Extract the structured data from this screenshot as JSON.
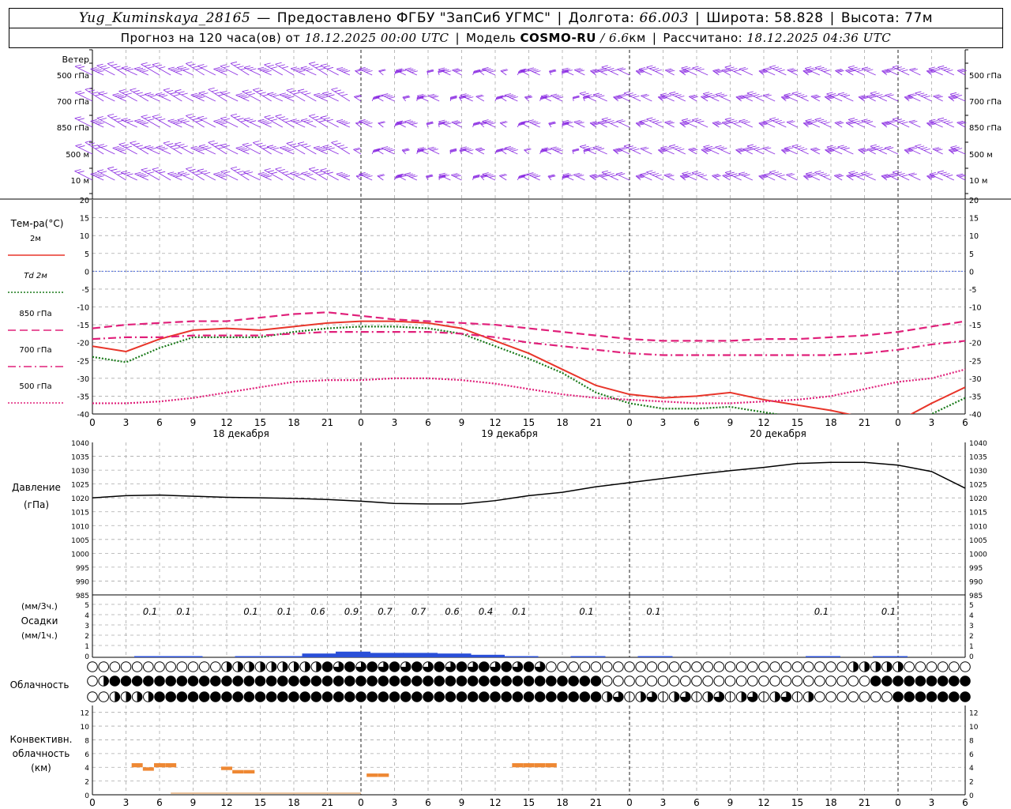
{
  "header": {
    "station": "Yug_Kuminskaya_28165",
    "dash": "—",
    "provider": "Предоставлено ФГБУ \"ЗапСиб УГМС\"",
    "lon_label": "Долгота:",
    "lon": "66.003",
    "lat_label": "Широта:",
    "lat": "58.828",
    "alt_label": "Высота:",
    "alt": "77м",
    "forecast_label": "Прогноз на 120 часа(ов) от",
    "run_time": "18.12.2025 00:00 UTC",
    "model_label": "Модель",
    "model": "COSMO-RU",
    "model_res": "/ 6.6",
    "model_res_unit": "км",
    "calc_label": "Рассчитано:",
    "calc_time": "18.12.2025 04:36 UTC"
  },
  "wind_panel": {
    "title": "Ветер",
    "levels": [
      "500 гПа",
      "700 гПа",
      "850 гПа",
      "500 м",
      "10  м"
    ],
    "barb_color": "#8a2be2"
  },
  "temp_panel": {
    "title": "Тем-ра(°C)",
    "legend": [
      {
        "label": "2м",
        "color": "#e8352a",
        "style": "solid"
      },
      {
        "label": "Td  2м",
        "color": "#1a7a1a",
        "style": "dotted"
      },
      {
        "label": "850 гПа",
        "color": "#e0207a",
        "style": "longdash"
      },
      {
        "label": "700 гПа",
        "color": "#e0207a",
        "style": "dashdot"
      },
      {
        "label": "500 гПа",
        "color": "#e0207a",
        "style": "dotted"
      }
    ],
    "x_ticks": [
      "0",
      "3",
      "6",
      "9",
      "12",
      "15",
      "18",
      "21",
      "0",
      "3",
      "6",
      "9",
      "12",
      "15",
      "18",
      "21",
      "0",
      "3",
      "6",
      "9",
      "12",
      "15",
      "18",
      "21",
      "0",
      "3",
      "6"
    ],
    "days": [
      "18 декабря",
      "19 декабря",
      "20 декабря"
    ]
  },
  "pressure_panel": {
    "title": "Давление",
    "unit": "(гПа)",
    "y_ticks": [
      "1040",
      "1035",
      "1030",
      "1025",
      "1020",
      "1015",
      "1010",
      "1005",
      "1000",
      "995",
      "990",
      "985"
    ]
  },
  "precip_panel": {
    "unit3h": "(мм/3ч.)",
    "title": "Осадки",
    "unit1h": "(мм/1ч.)",
    "y_ticks": [
      "5",
      "4",
      "3",
      "2",
      "1",
      "0"
    ],
    "amounts": [
      {
        "h": 6,
        "v": "0.1"
      },
      {
        "h": 9,
        "v": "0.1"
      },
      {
        "h": 15,
        "v": "0.1"
      },
      {
        "h": 18,
        "v": "0.1"
      },
      {
        "h": 21,
        "v": "0.6"
      },
      {
        "h": 24,
        "v": "0.9"
      },
      {
        "h": 27,
        "v": "0.7"
      },
      {
        "h": 30,
        "v": "0.7"
      },
      {
        "h": 33,
        "v": "0.6"
      },
      {
        "h": 36,
        "v": "0.4"
      },
      {
        "h": 39,
        "v": "0.1"
      },
      {
        "h": 45,
        "v": "0.1"
      },
      {
        "h": 51,
        "v": "0.1"
      },
      {
        "h": 66,
        "v": "0.1"
      },
      {
        "h": 72,
        "v": "0.1"
      }
    ]
  },
  "cloud_panel": {
    "title": "Облачность"
  },
  "conv_panel": {
    "title_lines": [
      "Конвективн.",
      "облачность",
      "(км)"
    ],
    "y_ticks": [
      "12",
      "10",
      "8",
      "6",
      "4",
      "2",
      "0"
    ],
    "x_ticks": [
      "0",
      "3",
      "6",
      "9",
      "12",
      "15",
      "18",
      "21",
      "0",
      "3",
      "6",
      "9",
      "12",
      "15",
      "18",
      "21",
      "0",
      "3",
      "6",
      "9",
      "12",
      "15",
      "18",
      "21",
      "0",
      "3",
      "6"
    ]
  },
  "chart_data": [
    {
      "type": "line",
      "title": "Тем-ра(°C)",
      "x_unit": "hours from 18.12.2025 00:00 UTC",
      "ylim": [
        -40,
        20
      ],
      "series": [
        {
          "name": "2м",
          "x": [
            0,
            3,
            6,
            9,
            12,
            15,
            18,
            21,
            24,
            27,
            30,
            33,
            36,
            39,
            42,
            45,
            48,
            51,
            54,
            57,
            60,
            63,
            66,
            69,
            72,
            75,
            78
          ],
          "values": [
            -21,
            -22.5,
            -19,
            -16.5,
            -16,
            -16.5,
            -15.5,
            -14.5,
            -14,
            -14,
            -14.5,
            -16,
            -19.5,
            -23,
            -27.5,
            -32,
            -34.5,
            -35.5,
            -35,
            -34,
            -36,
            -37.5,
            -39,
            -41,
            -42,
            -37,
            -32.5
          ]
        },
        {
          "name": "Td  2м",
          "x": [
            0,
            3,
            6,
            9,
            12,
            15,
            18,
            21,
            24,
            27,
            30,
            33,
            36,
            39,
            42,
            45,
            48,
            51,
            54,
            57,
            60,
            63,
            66,
            69,
            72,
            75,
            78
          ],
          "values": [
            -24,
            -25.5,
            -21.5,
            -18.5,
            -18.5,
            -18.5,
            -17,
            -16,
            -15.5,
            -15.5,
            -16,
            -17.5,
            -21,
            -24.5,
            -28.5,
            -34,
            -37,
            -38.5,
            -38.5,
            -38,
            -39.5,
            -41,
            -43,
            -44,
            -44,
            -40,
            -35.5
          ]
        },
        {
          "name": "850 гПа",
          "x": [
            0,
            3,
            6,
            9,
            12,
            15,
            18,
            21,
            24,
            27,
            30,
            33,
            36,
            39,
            42,
            45,
            48,
            51,
            54,
            57,
            60,
            63,
            66,
            69,
            72,
            75,
            78
          ],
          "values": [
            -16,
            -15,
            -14.5,
            -14,
            -14,
            -13,
            -12,
            -11.5,
            -12.5,
            -13.5,
            -14,
            -14.5,
            -15,
            -16,
            -17,
            -18,
            -19,
            -19.5,
            -19.5,
            -19.5,
            -19,
            -19,
            -18.5,
            -18,
            -17,
            -15.5,
            -14
          ]
        },
        {
          "name": "700 гПа",
          "x": [
            0,
            3,
            6,
            9,
            12,
            15,
            18,
            21,
            24,
            27,
            30,
            33,
            36,
            39,
            42,
            45,
            48,
            51,
            54,
            57,
            60,
            63,
            66,
            69,
            72,
            75,
            78
          ],
          "values": [
            -19,
            -18.5,
            -18.5,
            -18,
            -18,
            -18,
            -17.5,
            -17,
            -17,
            -17,
            -17,
            -17.5,
            -18.5,
            -20,
            -21,
            -22,
            -23,
            -23.5,
            -23.5,
            -23.5,
            -23.5,
            -23.5,
            -23.5,
            -23,
            -22,
            -20.5,
            -19.5
          ]
        },
        {
          "name": "500 гПа",
          "x": [
            0,
            3,
            6,
            9,
            12,
            15,
            18,
            21,
            24,
            27,
            30,
            33,
            36,
            39,
            42,
            45,
            48,
            51,
            54,
            57,
            60,
            63,
            66,
            69,
            72,
            75,
            78
          ],
          "values": [
            -37,
            -37,
            -36.5,
            -35.5,
            -34,
            -32.5,
            -31,
            -30.5,
            -30.5,
            -30,
            -30,
            -30.5,
            -31.5,
            -33,
            -34.5,
            -35.5,
            -36,
            -36.5,
            -37,
            -37,
            -36.5,
            -36,
            -35,
            -33,
            -31,
            -30,
            -27.5
          ]
        }
      ]
    },
    {
      "type": "line",
      "title": "Давление",
      "ylim": [
        985,
        1040
      ],
      "series": [
        {
          "name": "Давление",
          "x": [
            0,
            3,
            6,
            9,
            12,
            15,
            18,
            21,
            24,
            27,
            30,
            33,
            36,
            39,
            42,
            45,
            48,
            51,
            54,
            57,
            60,
            63,
            66,
            69,
            72,
            75,
            78
          ],
          "values": [
            1020,
            1020.8,
            1021,
            1020.6,
            1020.2,
            1020,
            1019.8,
            1019.4,
            1018.8,
            1018,
            1017.8,
            1017.8,
            1019,
            1020.8,
            1022,
            1024,
            1025.5,
            1027,
            1028.5,
            1029.8,
            1031,
            1032.4,
            1032.8,
            1032.8,
            1031.8,
            1029.5,
            1023.5
          ]
        }
      ]
    },
    {
      "type": "bar",
      "title": "Осадки",
      "ylim": [
        0,
        5
      ],
      "series": [
        {
          "name": "Осадки",
          "x": [
            6,
            9,
            15,
            18,
            21,
            24,
            27,
            30,
            33,
            36,
            39,
            45,
            51,
            66,
            72
          ],
          "values": [
            0.1,
            0.1,
            0.1,
            0.1,
            0.6,
            0.9,
            0.7,
            0.7,
            0.6,
            0.4,
            0.1,
            0.1,
            0.1,
            0.1,
            0.1
          ]
        }
      ]
    },
    {
      "type": "bar",
      "title": "Конвективн. облачность (км)",
      "ylim": [
        0,
        13
      ],
      "series": [
        {
          "name": "base_top_km",
          "x": [
            4,
            5,
            6,
            7,
            12,
            13,
            14,
            25,
            26,
            38,
            39,
            40,
            41
          ],
          "values": [
            [
              4,
              4.6
            ],
            [
              3.5,
              4
            ],
            [
              4,
              4.6
            ],
            [
              4,
              4.6
            ],
            [
              3.6,
              4.1
            ],
            [
              3.1,
              3.6
            ],
            [
              3.1,
              3.6
            ],
            [
              2.6,
              3.1
            ],
            [
              2.6,
              3.1
            ],
            [
              4,
              4.6
            ],
            [
              4,
              4.6
            ],
            [
              4,
              4.6
            ],
            [
              4,
              4.6
            ]
          ]
        }
      ]
    }
  ]
}
